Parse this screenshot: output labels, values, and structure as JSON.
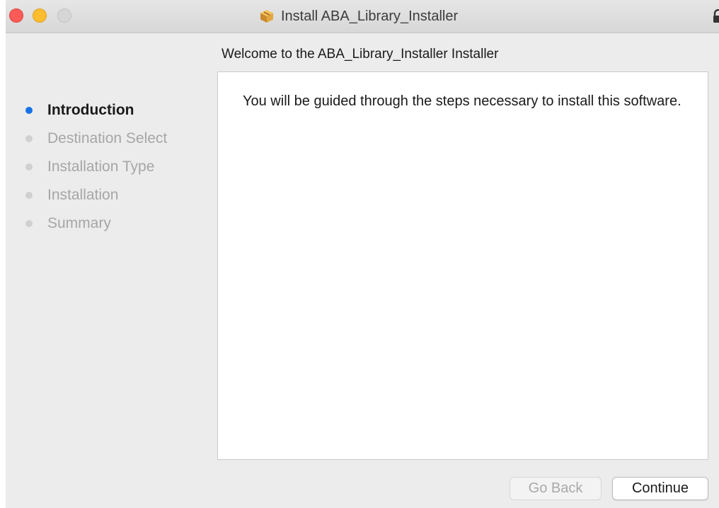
{
  "window": {
    "title": "Install ABA_Library_Installer",
    "title_icon": "package-box-icon"
  },
  "heading": "Welcome to the ABA_Library_Installer Installer",
  "steps": [
    {
      "label": "Introduction",
      "active": true
    },
    {
      "label": "Destination Select",
      "active": false
    },
    {
      "label": "Installation Type",
      "active": false
    },
    {
      "label": "Installation",
      "active": false
    },
    {
      "label": "Summary",
      "active": false
    }
  ],
  "content": {
    "text": "You will be guided through the steps necessary to install this software."
  },
  "buttons": {
    "go_back": "Go Back",
    "continue": "Continue"
  },
  "colors": {
    "accent": "#1672e8",
    "close": "#fc5b57",
    "minimize": "#fdbd2e"
  }
}
